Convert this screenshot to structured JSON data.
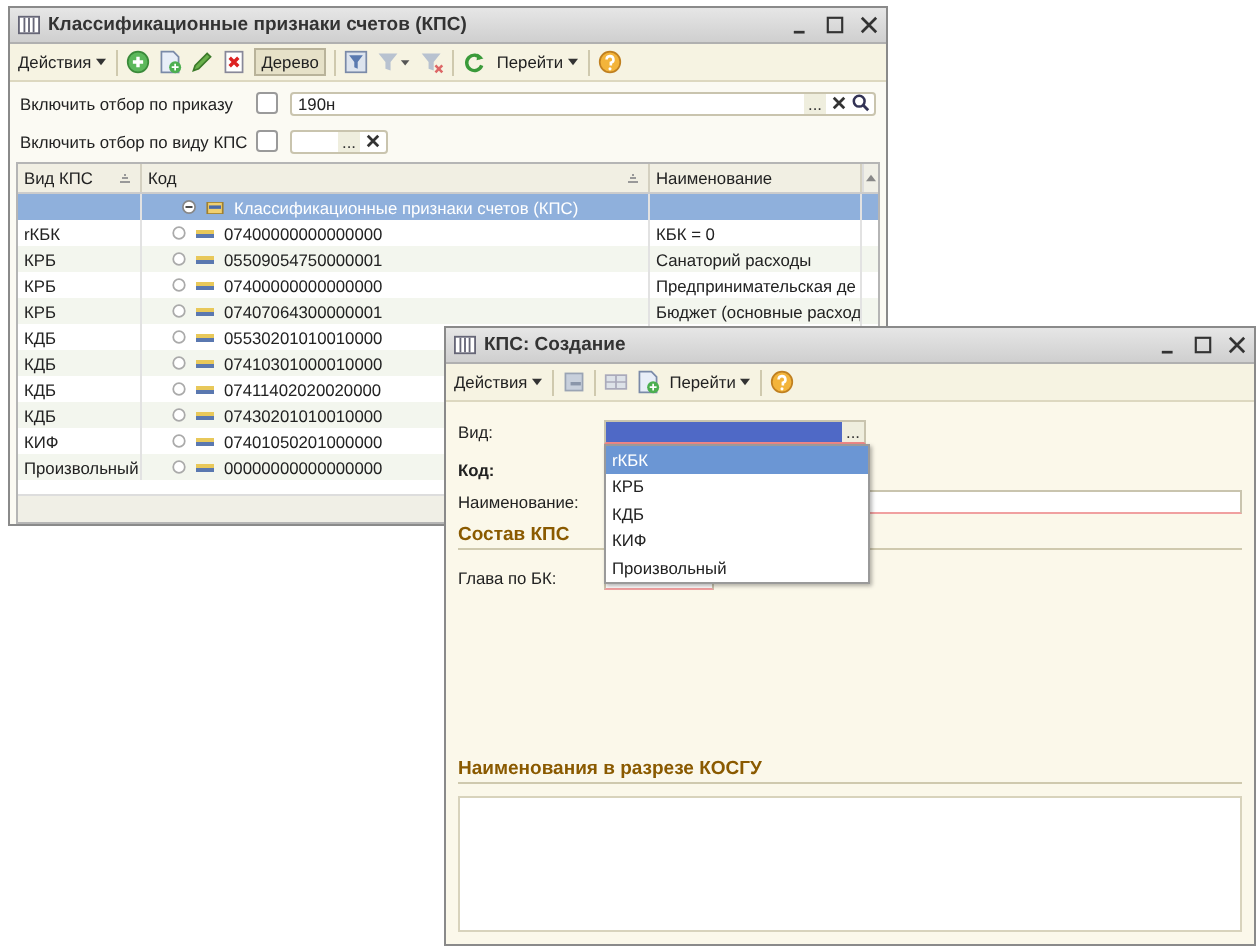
{
  "list_window": {
    "title": "Классификационные признаки счетов (КПС)",
    "toolbar": [
      {
        "kind": "menu",
        "label": "Действия"
      },
      {
        "kind": "separator"
      },
      {
        "kind": "add"
      },
      {
        "kind": "copy"
      },
      {
        "kind": "edit"
      },
      {
        "kind": "delete"
      },
      {
        "kind": "toggle",
        "label": "Дерево",
        "selected": true
      },
      {
        "kind": "separator"
      },
      {
        "kind": "filter"
      },
      {
        "kind": "filter-menu"
      },
      {
        "kind": "filter-off"
      },
      {
        "kind": "separator"
      },
      {
        "kind": "refresh"
      },
      {
        "kind": "menu",
        "label": "Перейти"
      },
      {
        "kind": "separator"
      },
      {
        "kind": "help"
      }
    ],
    "filters": [
      {
        "label": "Включить отбор по приказу",
        "checked": false,
        "value": "190н",
        "select_button": "...",
        "wide": true
      },
      {
        "label": "Включить отбор по виду КПС",
        "checked": false,
        "select_button": "...",
        "wide": false
      }
    ],
    "table": {
      "columns": [
        "Вид КПС",
        "Код",
        "Наименование"
      ],
      "rows": [
        {
          "code": "Классификационные признаки счетов (КПС)",
          "selected": true,
          "expanded": true,
          "children": [
            {
              "type": "rКБК",
              "code": "07400000000000000",
              "name": "КБК = 0",
              "selected": false
            },
            {
              "type": "КРБ",
              "code": "05509054750000001",
              "name": "Санаторий расходы",
              "selected": false
            },
            {
              "type": "КРБ",
              "code": "07400000000000000",
              "name": "Предпринимательская де",
              "selected": false
            },
            {
              "type": "КРБ",
              "code": "07407064300000001",
              "name": "Бюджет (основные расход",
              "selected": false
            },
            {
              "type": "КДБ",
              "code": "05530201010010000",
              "selected": false
            },
            {
              "type": "КДБ",
              "code": "07410301000010000",
              "selected": false
            },
            {
              "type": "КДБ",
              "code": "07411402020020000",
              "selected": false
            },
            {
              "type": "КДБ",
              "code": "07430201010010000",
              "selected": false
            },
            {
              "type": "КИФ",
              "code": "07401050201000000",
              "selected": false
            },
            {
              "type": "Произвольный",
              "code": "00000000000000000",
              "selected": false
            }
          ]
        }
      ]
    }
  },
  "form_window": {
    "title": "КПС: Создание",
    "toolbar": [
      {
        "kind": "menu",
        "label": "Действия"
      },
      {
        "kind": "separator"
      },
      {
        "kind": "save"
      },
      {
        "kind": "separator"
      },
      {
        "kind": "grid"
      },
      {
        "kind": "copy"
      },
      {
        "kind": "menu",
        "label": "Перейти"
      },
      {
        "kind": "separator"
      },
      {
        "kind": "help"
      }
    ],
    "vid": {
      "label": "Вид:",
      "select_button": "...",
      "options": [
        {
          "label": "rКБК",
          "selected": true
        },
        {
          "label": "КРБ",
          "selected": false
        },
        {
          "label": "КДБ",
          "selected": false
        },
        {
          "label": "КИФ",
          "selected": false
        },
        {
          "label": "Произвольный",
          "selected": false
        }
      ]
    },
    "code_label": "Код:",
    "name_label": "Наименование:",
    "section_1": "Состав КПС",
    "chapter_label": "Глава по БК:",
    "section_2": "Наименования в разрезе КОСГУ"
  }
}
